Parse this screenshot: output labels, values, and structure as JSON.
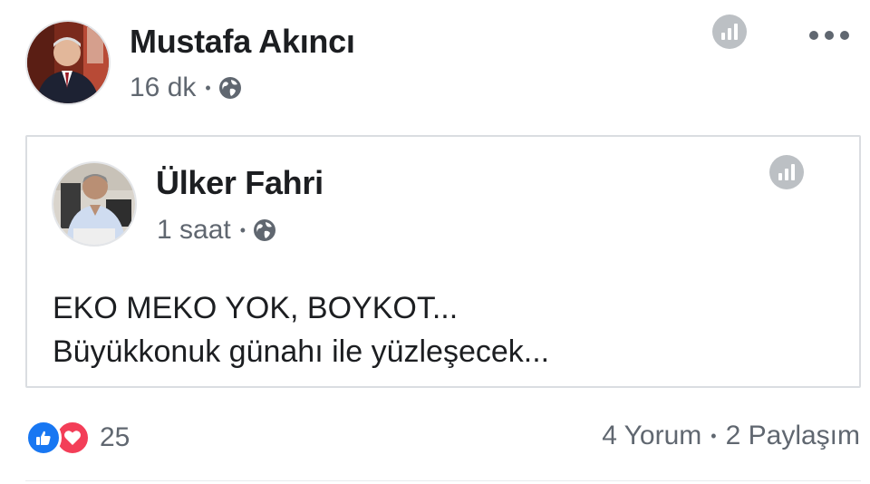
{
  "outer_post": {
    "author": "Mustafa Akıncı",
    "time": "16 dk",
    "separator": "•",
    "privacy_icon": "globe-icon",
    "insights_icon": "insights-icon",
    "more_icon": "more-options-icon"
  },
  "shared_post": {
    "author": "Ülker Fahri",
    "time": "1 saat",
    "separator": "•",
    "privacy_icon": "globe-icon",
    "insights_icon": "insights-icon",
    "text_lines": [
      "EKO MEKO YOK, BOYKOT...",
      "Büyükkonuk günahı ile yüzleşecek..."
    ]
  },
  "footer": {
    "reaction_icons": [
      "like-icon",
      "love-icon"
    ],
    "reaction_count": "25",
    "comments": "4 Yorum",
    "separator": "•",
    "shares": "2 Paylaşım"
  },
  "colors": {
    "text_primary": "#1c1e21",
    "text_secondary": "#606770",
    "like_blue": "#1877f2",
    "love_red": "#f33e58",
    "border": "#dadde1",
    "icon_gray": "#bcc0c4"
  }
}
